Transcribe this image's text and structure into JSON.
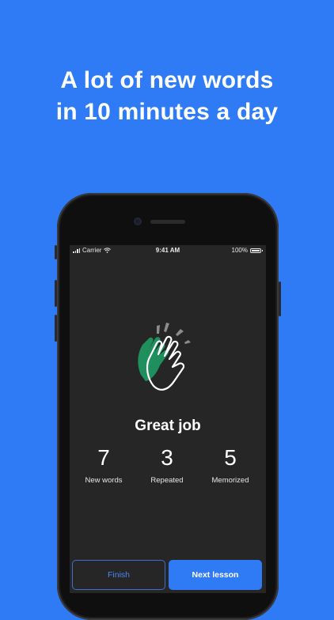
{
  "headline": {
    "line1": "A lot of new words",
    "line2": "in 10 minutes a day"
  },
  "status_bar": {
    "carrier": "Carrier",
    "time": "9:41 AM",
    "battery": "100%"
  },
  "result": {
    "title": "Great job",
    "stats": [
      {
        "value": "7",
        "label": "New words"
      },
      {
        "value": "3",
        "label": "Repeated"
      },
      {
        "value": "5",
        "label": "Memorized"
      }
    ]
  },
  "actions": {
    "finish_label": "Finish",
    "next_label": "Next lesson"
  },
  "colors": {
    "background": "#2f7bf5",
    "screen": "#262626",
    "accent": "#2f7bf5",
    "clap_green": "#1f8f5e"
  },
  "icons": {
    "clap": "clapping-hands-icon",
    "signal": "cellular-signal-icon",
    "wifi": "wifi-icon",
    "battery": "battery-icon"
  }
}
